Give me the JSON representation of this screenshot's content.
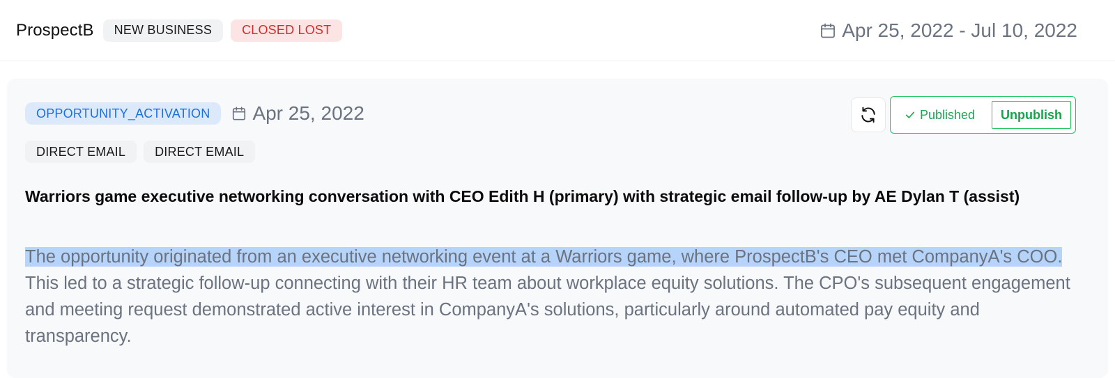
{
  "header": {
    "company": "ProspectB",
    "tags": [
      "NEW BUSINESS",
      "CLOSED LOST"
    ],
    "date_range": "Apr 25, 2022 - Jul 10, 2022"
  },
  "card": {
    "type": "OPPORTUNITY_ACTIVATION",
    "date": "Apr 25, 2022",
    "channels": [
      "DIRECT EMAIL",
      "DIRECT EMAIL"
    ],
    "status": "Published",
    "unpublish_label": "Unpublish",
    "title": "Warriors game executive networking conversation with CEO Edith H (primary) with strategic email follow-up by AE Dylan T (assist)",
    "description_selected": "The opportunity originated from an executive networking event at a Warriors game, where ProspectB's CEO met CompanyA's COO.",
    "description_rest": " This led to a strategic follow-up connecting with their HR team about workplace equity solutions. The CPO's subsequent engagement and meeting request demonstrated active interest in CompanyA's solutions, particularly around automated pay equity and transparency."
  },
  "colors": {
    "accent_blue": "#1d6fe0",
    "lost_red": "#d62c2c",
    "published_green": "#22a350",
    "selection": "#b6d4f9"
  },
  "icons": [
    "calendar-icon",
    "refresh-icon",
    "check-icon"
  ]
}
